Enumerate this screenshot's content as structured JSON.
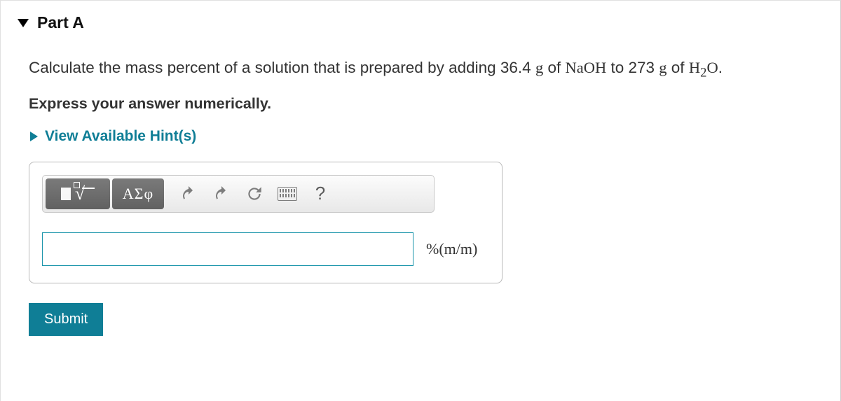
{
  "part": {
    "title": "Part A"
  },
  "question": {
    "prefix": "Calculate the mass percent of a solution that is prepared by adding 36.4 ",
    "g1": "g",
    "of1": " of ",
    "chem1": "NaOH",
    "mid": " to 273 ",
    "g2": "g",
    "of2": " of ",
    "chem2_h": "H",
    "chem2_sub": "2",
    "chem2_o": "O",
    "period": "."
  },
  "instruction": "Express your answer numerically.",
  "hints_label": "View Available Hint(s)",
  "toolbar": {
    "greek_label": "ΑΣφ",
    "help_label": "?"
  },
  "answer": {
    "value": "",
    "unit_text": "%(m/m)"
  },
  "submit_label": "Submit"
}
